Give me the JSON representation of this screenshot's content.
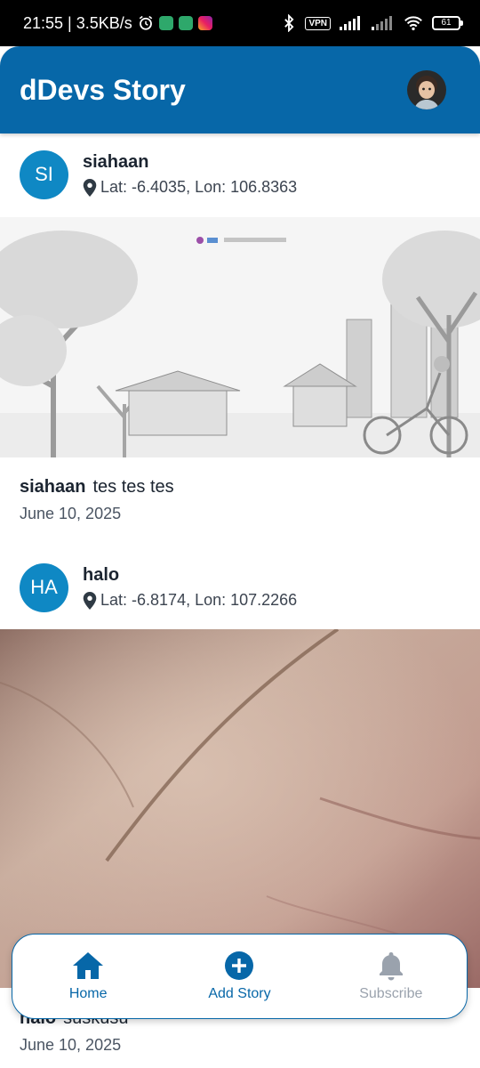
{
  "status_bar": {
    "time_speed": "21:55 | 3.5KB/s",
    "vpn": "VPN",
    "battery": "61"
  },
  "app_bar": {
    "title": "dDevs Story"
  },
  "stories": [
    {
      "initials": "SI",
      "username": "siahaan",
      "location": "Lat: -6.4035, Lon: 106.8363",
      "caption_user": "siahaan",
      "caption_text": "tes tes tes",
      "date": "June 10, 2025"
    },
    {
      "initials": "HA",
      "username": "halo",
      "location": "Lat: -6.8174, Lon: 107.2266",
      "caption_user": "halo",
      "caption_text": "suskusu",
      "date": "June 10, 2025"
    }
  ],
  "bottom_nav": {
    "home": "Home",
    "add_story": "Add Story",
    "subscribe": "Subscribe"
  },
  "colors": {
    "primary": "#0767a8",
    "avatar_bg": "#0f88c4",
    "inactive": "#9aa2ad"
  },
  "icons": {
    "home": "home-icon",
    "add": "add-circle-icon",
    "bell": "bell-icon",
    "location": "location-pin-icon"
  }
}
